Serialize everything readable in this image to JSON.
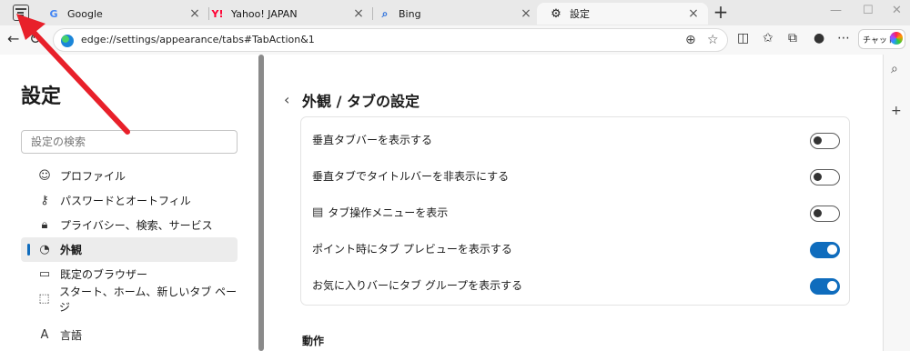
{
  "tabs": [
    {
      "title": "Google",
      "icon": "google-icon"
    },
    {
      "title": "Yahoo! JAPAN",
      "icon": "yahoo-icon"
    },
    {
      "title": "Bing",
      "icon": "bing-icon"
    },
    {
      "title": "設定",
      "icon": "gear-icon"
    }
  ],
  "window": {
    "new_tab": "+",
    "minimize": "—",
    "maximize": "☐",
    "close": "✕"
  },
  "address": {
    "url": "edge://settings/appearance/tabs#TabAction&1"
  },
  "toolbar": {
    "chat_label": "チャット"
  },
  "sidebar": {
    "title": "設定",
    "search_placeholder": "設定の検索",
    "items": [
      {
        "label": "プロファイル",
        "icon": "profile-icon"
      },
      {
        "label": "パスワードとオートフィル",
        "icon": "key-icon"
      },
      {
        "label": "プライバシー、検索、サービス",
        "icon": "lock-icon"
      },
      {
        "label": "外観",
        "icon": "palette-icon",
        "active": true
      },
      {
        "label": "既定のブラウザー",
        "icon": "browser-icon"
      },
      {
        "label": "スタート、ホーム、新しいタブ ページ",
        "icon": "home-page-icon"
      },
      {
        "label": "言語",
        "icon": "language-icon"
      }
    ]
  },
  "main": {
    "title": "外観 / タブの設定",
    "settings": [
      {
        "label": "垂直タブバーを表示する",
        "enabled": false
      },
      {
        "label": "垂直タブでタイトルバーを非表示にする",
        "enabled": false
      },
      {
        "label": "タブ操作メニューを表示",
        "enabled": false,
        "icon": "tab-action-menu-icon"
      },
      {
        "label": "ポイント時にタブ プレビューを表示する",
        "enabled": true
      },
      {
        "label": "お気に入りバーにタブ グループを表示する",
        "enabled": true
      }
    ],
    "section_heading": "動作"
  },
  "colors": {
    "accent": "#0f6cbd",
    "annotation_arrow": "#e8202a"
  }
}
